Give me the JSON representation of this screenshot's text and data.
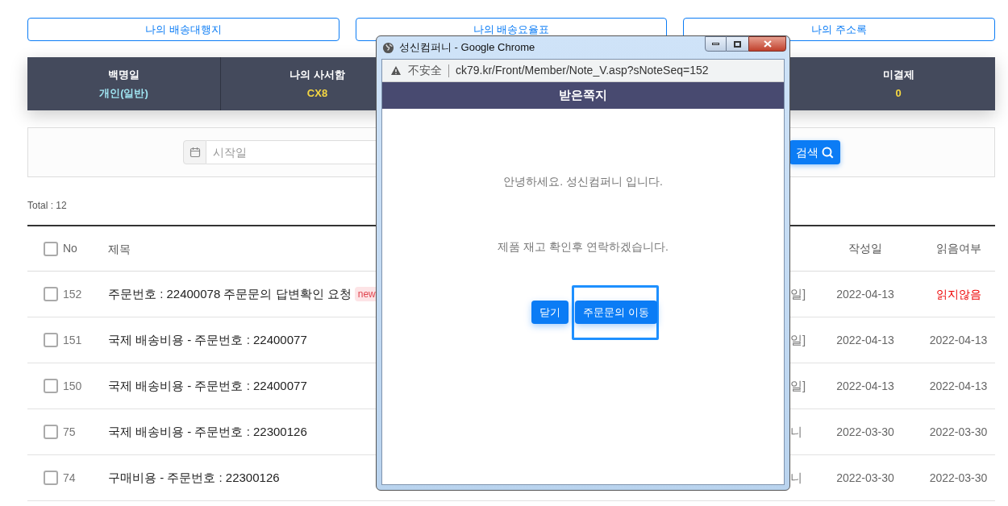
{
  "nav_buttons": [
    "나의 배송대행지",
    "나의 배송요율표",
    "나의 주소록"
  ],
  "summary": [
    {
      "label": "백명일",
      "value": "개인(일반)",
      "kind": "grade"
    },
    {
      "label": "나의 사서함",
      "value": "CX8",
      "kind": "count"
    },
    {
      "label": "미결제",
      "value": "0",
      "kind": "count"
    }
  ],
  "search": {
    "placeholder": "시작일",
    "button": "검색"
  },
  "total": "Total : 12",
  "table": {
    "columns": {
      "no": "No",
      "title": "제목",
      "date": "작성일",
      "read": "읽음여부"
    },
    "all_checked": false,
    "rows": [
      {
        "checked": false,
        "no": "152",
        "title": "주문번호 : 22400078 주문문의 답변확인 요청",
        "badge": "new",
        "column_3": "일]",
        "date": "2022-04-13",
        "read": false,
        "read_text": "읽지않음"
      },
      {
        "checked": false,
        "no": "151",
        "title": "국제 배송비용 - 주문번호 : 22400077",
        "column_3": "일]",
        "date": "2022-04-13",
        "read": true,
        "read_text": "2022-04-13"
      },
      {
        "checked": false,
        "no": "150",
        "title": "국제 배송비용 - 주문번호 : 22400077",
        "column_3": "일]",
        "date": "2022-04-13",
        "read": true,
        "read_text": "2022-04-13"
      },
      {
        "checked": false,
        "no": "75",
        "title": "국제 배송비용 - 주문번호 : 22300126",
        "column_3": "니",
        "date": "2022-03-30",
        "read": true,
        "read_text": "2022-03-30"
      },
      {
        "checked": false,
        "no": "74",
        "title": "구매비용 - 주문번호 : 22300126",
        "column_3": "니",
        "date": "2022-03-30",
        "read": true,
        "read_text": "2022-03-30"
      }
    ]
  },
  "popup": {
    "title": "성신컴퍼니 - Google Chrome",
    "security": "不安全",
    "url": "ck79.kr/Front/Member/Note_V.asp?sNoteSeq=152",
    "heading": "받은쪽지",
    "messages": [
      "안녕하세요. 성신컴퍼니 입니다.",
      "제품 재고 확인후 연락하겠습니다."
    ],
    "buttons": [
      {
        "label": "닫기",
        "focused": false
      },
      {
        "label": "주문문의 이동",
        "focused": true
      }
    ]
  }
}
